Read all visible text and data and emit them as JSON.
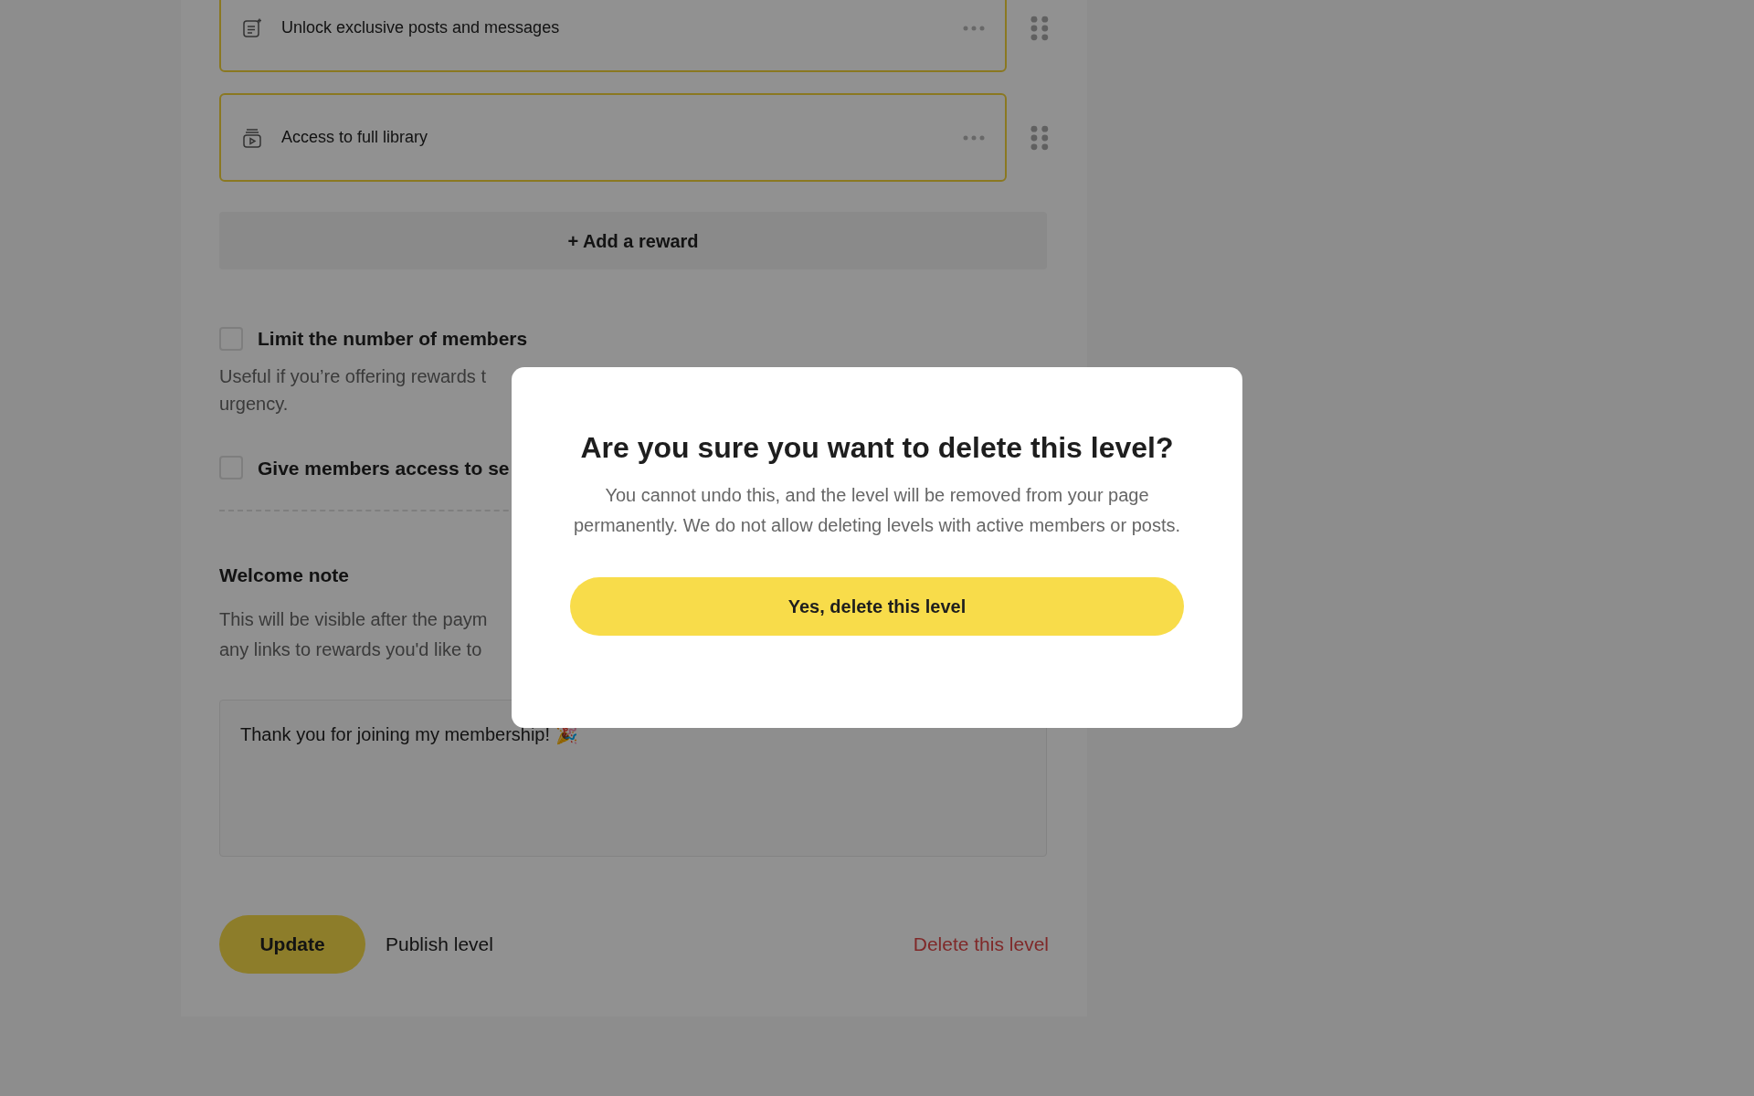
{
  "rewards": [
    {
      "kind": "posts",
      "label": "Unlock exclusive posts and messages"
    },
    {
      "kind": "library",
      "label": "Access to full library"
    }
  ],
  "add_reward": "+ Add a reward",
  "options": [
    {
      "label": "Limit the number of members",
      "checked": false,
      "description_lines": [
        "Useful if you’re offering rewards t",
        "urgency."
      ]
    },
    {
      "label": "Give members access to se",
      "checked": false
    }
  ],
  "welcome_note": {
    "heading": "Welcome note",
    "description_lines": [
      "This will be visible after the paym",
      "any links to rewards you'd like to"
    ],
    "value": "Thank you for joining my membership! 🎉"
  },
  "actions": {
    "update": "Update",
    "publish": "Publish level",
    "delete": "Delete this level"
  },
  "dialog": {
    "title": "Are you sure you want to delete this level?",
    "message": "You cannot undo this, and the level will be removed from your page permanently. We do not allow deleting levels with active members or posts.",
    "confirm": "Yes, delete this level"
  }
}
